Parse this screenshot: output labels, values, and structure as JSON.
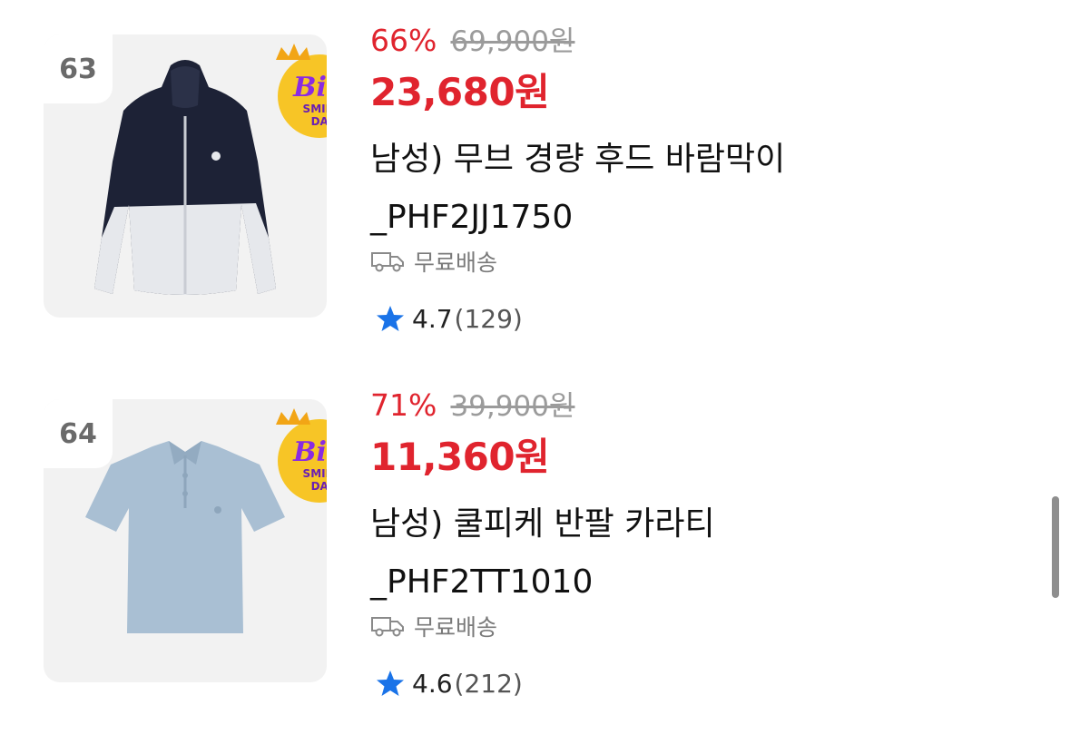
{
  "products": [
    {
      "rank": "63",
      "discount": "66%",
      "original_price": "69,900원",
      "price": "23,680원",
      "name_line1": "남성) 무브 경량 후드 바람막이",
      "name_line2": "_PHF2JJ1750",
      "shipping": "무료배송",
      "rating": "4.7",
      "review_count": "(129)",
      "badge": {
        "big": "Big",
        "line1": "SMILE",
        "line2": "DAY"
      }
    },
    {
      "rank": "64",
      "discount": "71%",
      "original_price": "39,900원",
      "price": "11,360원",
      "name_line1": "남성) 쿨피케 반팔 카라티",
      "name_line2": "_PHF2TT1010",
      "shipping": "무료배송",
      "rating": "4.6",
      "review_count": "(212)",
      "badge": {
        "big": "Big",
        "line1": "SMILE",
        "line2": "DAY"
      }
    }
  ],
  "colors": {
    "accent_red": "#e0242e",
    "muted_gray": "#9b9b9b",
    "star_blue": "#1a73e8",
    "badge_yellow": "#f7c526",
    "badge_purple": "#8a2be2"
  },
  "icons": {
    "shipping": "truck-icon",
    "rating": "star-icon",
    "badge_crown": "crown-icon"
  }
}
